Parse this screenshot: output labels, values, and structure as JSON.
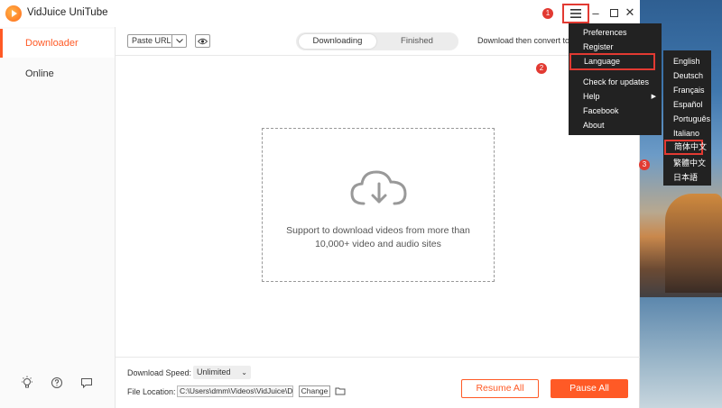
{
  "app": {
    "title": "VidJuice UniTube",
    "accent_color": "#ff5a26"
  },
  "window_controls": {
    "menu_icon": "hamburger-menu-icon",
    "minimize": "–",
    "maximize": "☐",
    "close": "✕"
  },
  "annotations": {
    "step1": "1",
    "step2": "2",
    "step3": "3",
    "highlight_color": "#e23a32"
  },
  "sidebar": {
    "items": [
      {
        "label": "Downloader",
        "active": true
      },
      {
        "label": "Online",
        "active": false
      }
    ],
    "bottom_icons": [
      "bulb-icon",
      "help-icon",
      "feedback-icon"
    ]
  },
  "toolbar": {
    "paste_url_label": "Paste URL",
    "tabs": [
      {
        "label": "Downloading",
        "active": true
      },
      {
        "label": "Finished",
        "active": false
      }
    ],
    "convert_label": "Download then convert to"
  },
  "dropzone": {
    "line1": "Support to download videos from more than",
    "line2": "10,000+ video and audio sites"
  },
  "footer": {
    "speed_label": "Download Speed:",
    "speed_value": "Unlimited",
    "location_label": "File Location:",
    "location_value": "C:\\Users\\dmm\\Videos\\VidJuice\\D",
    "change_label": "Change",
    "resume_label": "Resume All",
    "pause_label": "Pause All"
  },
  "main_menu": {
    "items": [
      {
        "label": "Preferences",
        "has_submenu": false
      },
      {
        "label": "Register",
        "has_submenu": false
      },
      {
        "label": "Language",
        "has_submenu": false,
        "highlighted": true
      },
      {
        "label": "Check for updates",
        "has_submenu": false
      },
      {
        "label": "Help",
        "has_submenu": true
      },
      {
        "label": "Facebook",
        "has_submenu": false
      },
      {
        "label": "About",
        "has_submenu": false
      }
    ]
  },
  "language_menu": {
    "items": [
      {
        "label": "English"
      },
      {
        "label": "Deutsch"
      },
      {
        "label": "Français"
      },
      {
        "label": "Español"
      },
      {
        "label": "Português"
      },
      {
        "label": "Italiano"
      },
      {
        "label": "简体中文",
        "highlighted": true
      },
      {
        "label": "繁體中文"
      },
      {
        "label": "日本語"
      }
    ]
  }
}
